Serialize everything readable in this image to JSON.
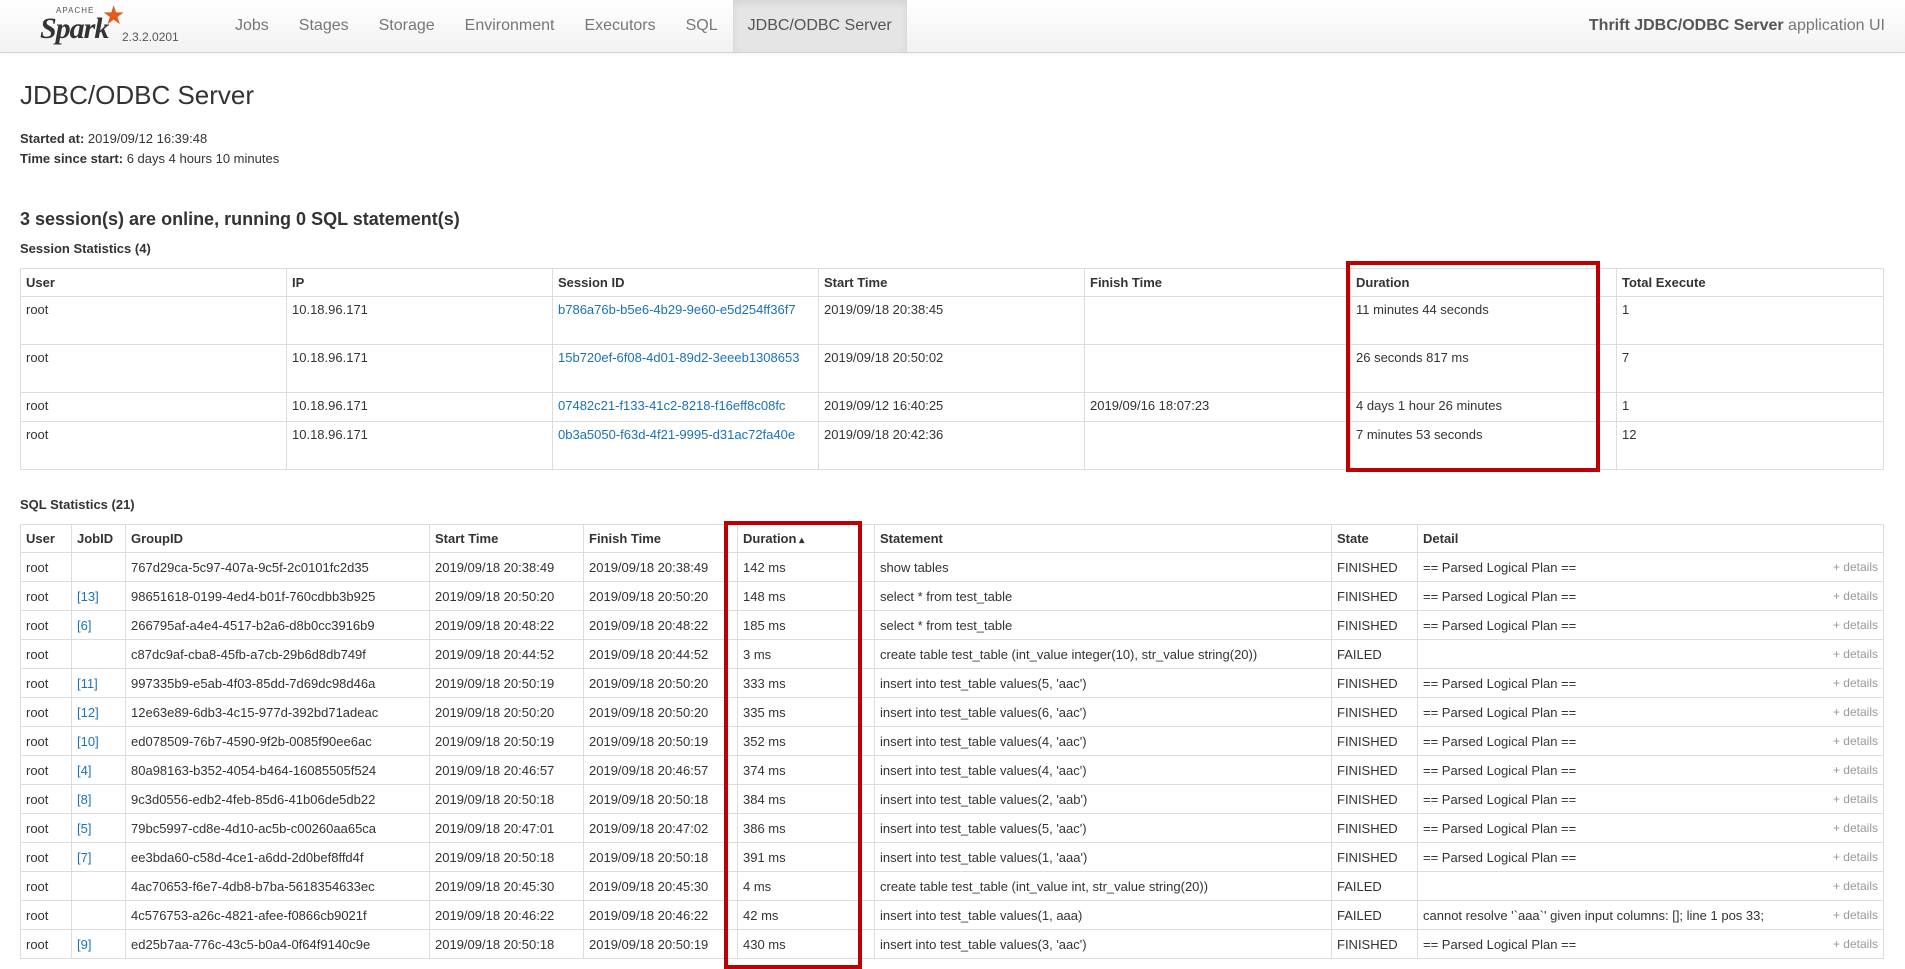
{
  "brand": {
    "apache": "APACHE",
    "name": "Spark",
    "version": "2.3.2.0201"
  },
  "nav": [
    "Jobs",
    "Stages",
    "Storage",
    "Environment",
    "Executors",
    "SQL",
    "JDBC/ODBC Server"
  ],
  "app_title": {
    "bold": "Thrift JDBC/ODBC Server",
    "rest": " application UI"
  },
  "page_title": "JDBC/ODBC Server",
  "started_at": {
    "label": "Started at:",
    "value": "2019/09/12 16:39:48"
  },
  "time_since_start": {
    "label": "Time since start:",
    "value": "6 days 4 hours 10 minutes"
  },
  "online_summary": "3 session(s) are online, running 0 SQL statement(s)",
  "session_stats": {
    "title": "Session Statistics (4)",
    "headers": [
      "User",
      "IP",
      "Session ID",
      "Start Time",
      "Finish Time",
      "Duration",
      "Total Execute"
    ],
    "rows": [
      [
        "root",
        "10.18.96.171",
        "b786a76b-b5e6-4b29-9e60-e5d254ff36f7",
        "2019/09/18 20:38:45",
        "",
        "11 minutes 44 seconds",
        "1"
      ],
      [
        "root",
        "10.18.96.171",
        "15b720ef-6f08-4d01-89d2-3eeeb1308653",
        "2019/09/18 20:50:02",
        "",
        "26 seconds 817 ms",
        "7"
      ],
      [
        "root",
        "10.18.96.171",
        "07482c21-f133-41c2-8218-f16eff8c08fc",
        "2019/09/12 16:40:25",
        "2019/09/16 18:07:23",
        "4 days 1 hour 26 minutes",
        "1"
      ],
      [
        "root",
        "10.18.96.171",
        "0b3a5050-f63d-4f21-9995-d31ac72fa40e",
        "2019/09/18 20:42:36",
        "",
        "7 minutes 53 seconds",
        "12"
      ]
    ]
  },
  "sql_stats": {
    "title": "SQL Statistics (21)",
    "headers": [
      "User",
      "JobID",
      "GroupID",
      "Start Time",
      "Finish Time",
      "Duration",
      "Statement",
      "State",
      "Detail"
    ],
    "details_label": "+ details",
    "rows": [
      [
        "root",
        "",
        "767d29ca-5c97-407a-9c5f-2c0101fc2d35",
        "2019/09/18 20:38:49",
        "2019/09/18 20:38:49",
        "142 ms",
        "show tables",
        "FINISHED",
        "== Parsed Logical Plan =="
      ],
      [
        "root",
        "[13]",
        "98651618-0199-4ed4-b01f-760cdbb3b925",
        "2019/09/18 20:50:20",
        "2019/09/18 20:50:20",
        "148 ms",
        "select * from test_table",
        "FINISHED",
        "== Parsed Logical Plan =="
      ],
      [
        "root",
        "[6]",
        "266795af-a4e4-4517-b2a6-d8b0cc3916b9",
        "2019/09/18 20:48:22",
        "2019/09/18 20:48:22",
        "185 ms",
        "select * from test_table",
        "FINISHED",
        "== Parsed Logical Plan =="
      ],
      [
        "root",
        "",
        "c87dc9af-cba8-45fb-a7cb-29b6d8db749f",
        "2019/09/18 20:44:52",
        "2019/09/18 20:44:52",
        "3 ms",
        "create table test_table (int_value integer(10), str_value string(20))",
        "FAILED",
        ""
      ],
      [
        "root",
        "[11]",
        "997335b9-e5ab-4f03-85dd-7d69dc98d46a",
        "2019/09/18 20:50:19",
        "2019/09/18 20:50:20",
        "333 ms",
        "insert into test_table values(5, 'aac')",
        "FINISHED",
        "== Parsed Logical Plan =="
      ],
      [
        "root",
        "[12]",
        "12e63e89-6db3-4c15-977d-392bd71adeac",
        "2019/09/18 20:50:20",
        "2019/09/18 20:50:20",
        "335 ms",
        "insert into test_table values(6, 'aac')",
        "FINISHED",
        "== Parsed Logical Plan =="
      ],
      [
        "root",
        "[10]",
        "ed078509-76b7-4590-9f2b-0085f90ee6ac",
        "2019/09/18 20:50:19",
        "2019/09/18 20:50:19",
        "352 ms",
        "insert into test_table values(4, 'aac')",
        "FINISHED",
        "== Parsed Logical Plan =="
      ],
      [
        "root",
        "[4]",
        "80a98163-b352-4054-b464-16085505f524",
        "2019/09/18 20:46:57",
        "2019/09/18 20:46:57",
        "374 ms",
        "insert into test_table values(4, 'aac')",
        "FINISHED",
        "== Parsed Logical Plan =="
      ],
      [
        "root",
        "[8]",
        "9c3d0556-edb2-4feb-85d6-41b06de5db22",
        "2019/09/18 20:50:18",
        "2019/09/18 20:50:18",
        "384 ms",
        "insert into test_table values(2, 'aab')",
        "FINISHED",
        "== Parsed Logical Plan =="
      ],
      [
        "root",
        "[5]",
        "79bc5997-cd8e-4d10-ac5b-c00260aa65ca",
        "2019/09/18 20:47:01",
        "2019/09/18 20:47:02",
        "386 ms",
        "insert into test_table values(5, 'aac')",
        "FINISHED",
        "== Parsed Logical Plan =="
      ],
      [
        "root",
        "[7]",
        "ee3bda60-c58d-4ce1-a6dd-2d0bef8ffd4f",
        "2019/09/18 20:50:18",
        "2019/09/18 20:50:18",
        "391 ms",
        "insert into test_table values(1, 'aaa')",
        "FINISHED",
        "== Parsed Logical Plan =="
      ],
      [
        "root",
        "",
        "4ac70653-f6e7-4db8-b7ba-5618354633ec",
        "2019/09/18 20:45:30",
        "2019/09/18 20:45:30",
        "4 ms",
        "create table test_table (int_value int, str_value string(20))",
        "FAILED",
        ""
      ],
      [
        "root",
        "",
        "4c576753-a26c-4821-afee-f0866cb9021f",
        "2019/09/18 20:46:22",
        "2019/09/18 20:46:22",
        "42 ms",
        "insert into test_table values(1, aaa)",
        "FAILED",
        "cannot resolve '`aaa`' given input columns: []; line 1 pos 33;"
      ],
      [
        "root",
        "[9]",
        "ed25b7aa-776c-43c5-b0a4-0f64f9140c9e",
        "2019/09/18 20:50:18",
        "2019/09/18 20:50:19",
        "430 ms",
        "insert into test_table values(3, 'aac')",
        "FINISHED",
        "== Parsed Logical Plan =="
      ]
    ]
  },
  "colors": {
    "link": "#1a72b8",
    "highlight": "#c00000",
    "spark_star": "#e25a1c"
  }
}
